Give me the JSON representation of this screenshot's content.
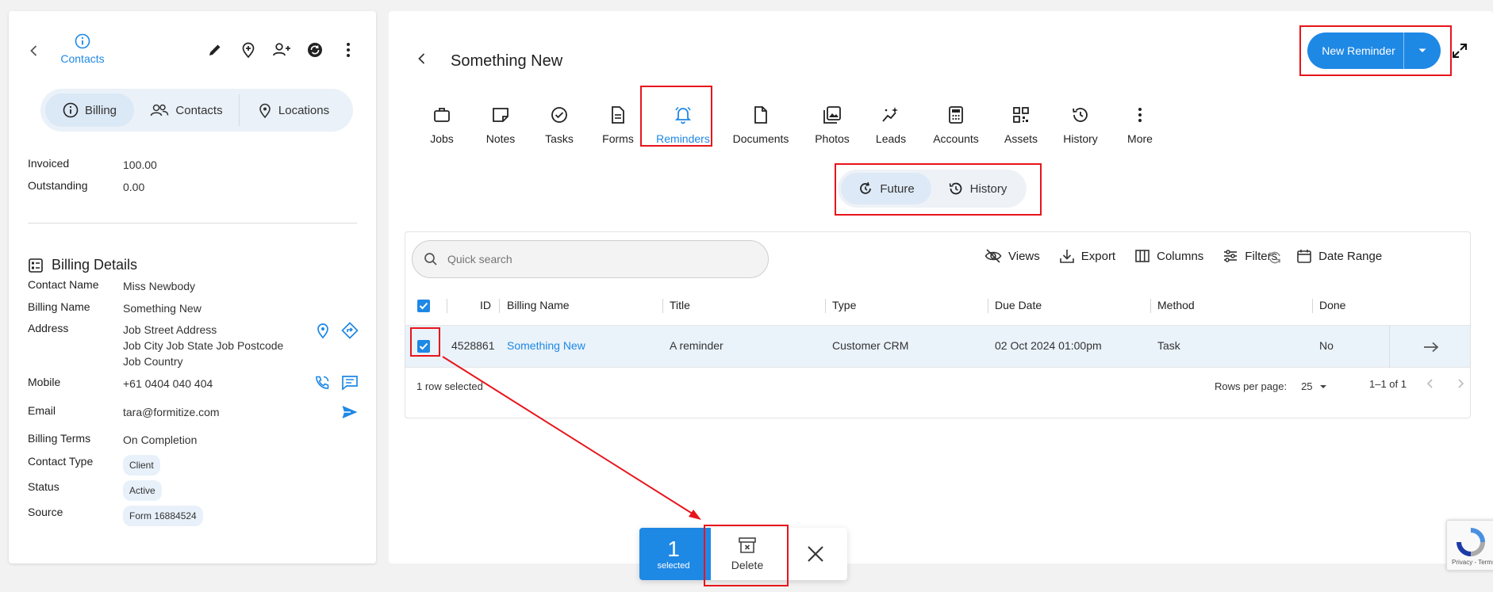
{
  "left_panel": {
    "header": {
      "contacts_label": "Contacts"
    },
    "segment": {
      "billing": "Billing",
      "contacts": "Contacts",
      "locations": "Locations"
    },
    "summary": [
      {
        "label": "Invoiced",
        "value": "100.00"
      },
      {
        "label": "Outstanding",
        "value": "0.00"
      }
    ],
    "billing_details": {
      "title": "Billing Details",
      "contact_name_label": "Contact Name",
      "contact_name": "Miss Newbody",
      "billing_name_label": "Billing Name",
      "billing_name": "Something New",
      "address_label": "Address",
      "address_line1": "Job Street Address",
      "address_line2": "Job City Job State Job Postcode",
      "address_line3": "Job Country",
      "mobile_label": "Mobile",
      "mobile": "+61 0404 040 404",
      "email_label": "Email",
      "email": "tara@formitize.com",
      "billing_terms_label": "Billing Terms",
      "billing_terms": "On Completion",
      "contact_type_label": "Contact Type",
      "contact_type": "Client",
      "status_label": "Status",
      "status": "Active",
      "source_label": "Source",
      "source": "Form 16884524"
    }
  },
  "main": {
    "title": "Something New",
    "new_reminder_label": "New Reminder",
    "tabs": [
      {
        "label": "Jobs",
        "icon": "briefcase-icon"
      },
      {
        "label": "Notes",
        "icon": "note-icon"
      },
      {
        "label": "Tasks",
        "icon": "check-circle-icon"
      },
      {
        "label": "Forms",
        "icon": "form-icon"
      },
      {
        "label": "Reminders",
        "icon": "bell-icon"
      },
      {
        "label": "Documents",
        "icon": "document-icon"
      },
      {
        "label": "Photos",
        "icon": "photos-icon"
      },
      {
        "label": "Leads",
        "icon": "sparkle-icon"
      },
      {
        "label": "Accounts",
        "icon": "calculator-icon"
      },
      {
        "label": "Assets",
        "icon": "qr-icon"
      },
      {
        "label": "History",
        "icon": "history-icon"
      },
      {
        "label": "More",
        "icon": "more-vertical-icon"
      }
    ],
    "active_tab": "Reminders",
    "toggle": {
      "future": "Future",
      "history": "History"
    },
    "grid": {
      "search_placeholder": "Quick search",
      "toolbar": {
        "views": "Views",
        "export": "Export",
        "columns": "Columns",
        "filters": "Filters",
        "date_range": "Date Range"
      },
      "columns": [
        "ID",
        "Billing Name",
        "Title",
        "Type",
        "Due Date",
        "Method",
        "Done"
      ],
      "rows": [
        {
          "id": "4528861",
          "billing_name": "Something New",
          "title": "A reminder",
          "type": "Customer CRM",
          "due_date": "02 Oct 2024 01:00pm",
          "method": "Task",
          "done": "No"
        }
      ],
      "footer": {
        "selected_text": "1 row selected",
        "rows_per_page_label": "Rows per page:",
        "rows_per_page": "25",
        "range": "1–1 of 1"
      }
    },
    "selection_bar": {
      "count": "1",
      "count_label": "selected",
      "delete_label": "Delete"
    }
  },
  "recaptcha": {
    "text": "Privacy - Terms"
  },
  "colors": {
    "accent": "#1e88e5",
    "annotation": "#e8141b",
    "row_selected": "#eaf2fa"
  }
}
